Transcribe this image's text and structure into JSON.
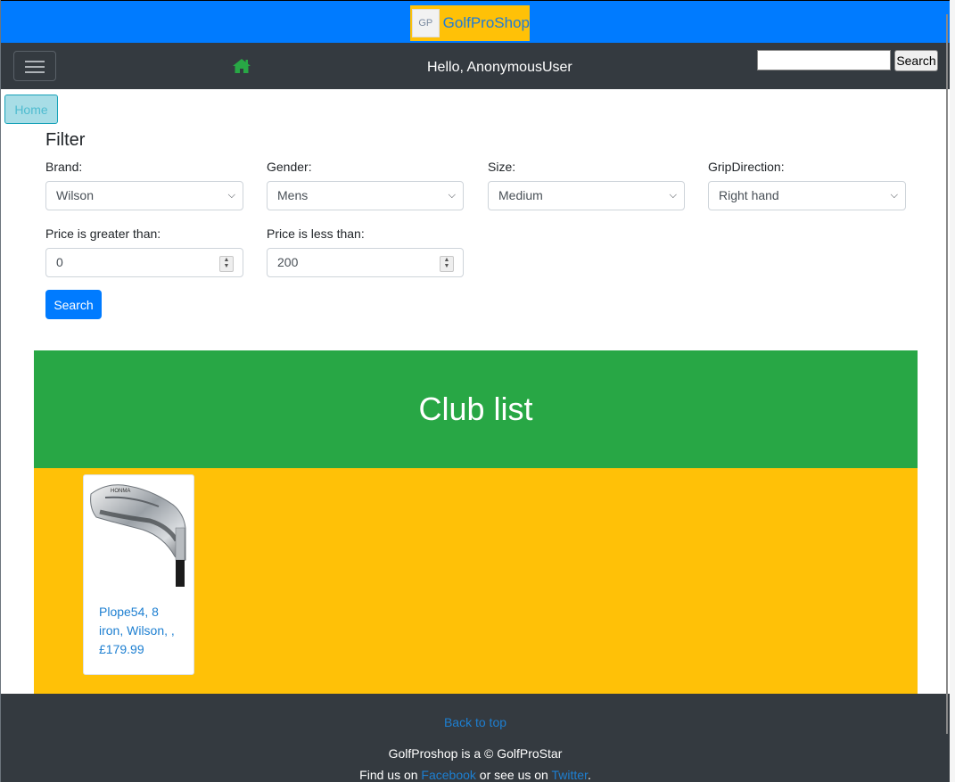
{
  "header": {
    "logo_text": "GP",
    "brand_name": "GolfProShop"
  },
  "navbar": {
    "greeting": "Hello, AnonymousUser",
    "search_value": "",
    "search_button": "Search"
  },
  "breadcrumb": {
    "home": "Home"
  },
  "filter": {
    "title": "Filter",
    "brand": {
      "label": "Brand:",
      "value": "Wilson"
    },
    "gender": {
      "label": "Gender:",
      "value": "Mens"
    },
    "size": {
      "label": "Size:",
      "value": "Medium"
    },
    "grip": {
      "label": "GripDirection:",
      "value": "Right hand"
    },
    "price_min": {
      "label": "Price is greater than:",
      "value": "0"
    },
    "price_max": {
      "label": "Price is less than:",
      "value": "200"
    },
    "search_button": "Search"
  },
  "club_list": {
    "title": "Club list",
    "items": [
      {
        "lines": [
          "Plope54, 8",
          "iron, Wilson, ,",
          "£179.99"
        ]
      }
    ]
  },
  "footer": {
    "back_to_top": "Back to top",
    "copyright": "GolfProshop is a © GolfProStar",
    "find_prefix": "Find us on ",
    "facebook": "Facebook",
    "middle": " or see us on ",
    "twitter": "Twitter",
    "end": "."
  },
  "colors": {
    "primary": "#007bff",
    "dark": "#343a40",
    "success": "#28a745",
    "warning": "#ffc107"
  }
}
